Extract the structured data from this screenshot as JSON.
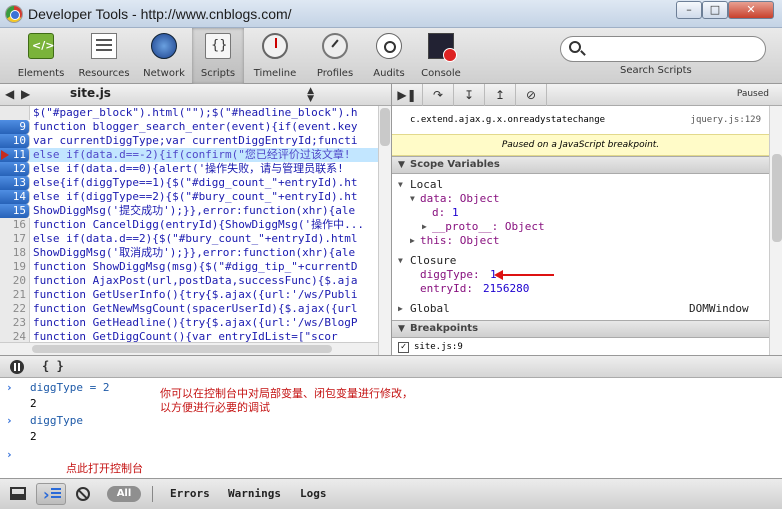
{
  "window": {
    "title": "Developer Tools - http://www.cnblogs.com/"
  },
  "toolbar": {
    "panels": [
      {
        "label": "Elements",
        "icon": "elements-icon"
      },
      {
        "label": "Resources",
        "icon": "resources-icon"
      },
      {
        "label": "Network",
        "icon": "network-icon"
      },
      {
        "label": "Scripts",
        "icon": "scripts-icon",
        "selected": true
      },
      {
        "label": "Timeline",
        "icon": "timeline-icon"
      },
      {
        "label": "Profiles",
        "icon": "profiles-icon"
      },
      {
        "label": "Audits",
        "icon": "audits-icon"
      },
      {
        "label": "Console",
        "icon": "console-icon"
      }
    ],
    "search_caption": "Search Scripts",
    "search_value": ""
  },
  "source": {
    "file": "site.js",
    "lines": [
      {
        "num": "",
        "text": "$(\"#pager_block\").html(\"\");$(\"#headline_block\").h"
      },
      {
        "num": "9",
        "breakpoint": true,
        "text": "function blogger_search_enter(event){if(event.key"
      },
      {
        "num": "10",
        "breakpoint": true,
        "text": "var currentDiggType;var currentDiggEntryId;functi"
      },
      {
        "num": "11",
        "breakpoint": true,
        "current": true,
        "text": "else if(data.d==-2){if(confirm(\"您已经评价过该文章!"
      },
      {
        "num": "12",
        "breakpoint": true,
        "text": "else if(data.d==0){alert('操作失败，请与管理员联系!"
      },
      {
        "num": "13",
        "breakpoint": true,
        "text": "else{if(diggType==1){$(\"#digg_count_\"+entryId).ht"
      },
      {
        "num": "14",
        "breakpoint": true,
        "text": "else if(diggType==2){$(\"#bury_count_\"+entryId).ht"
      },
      {
        "num": "15",
        "breakpoint": true,
        "text": "ShowDiggMsg('提交成功');}},error:function(xhr){ale"
      },
      {
        "num": "16",
        "text": "function CancelDigg(entryId){ShowDiggMsg('操作中..."
      },
      {
        "num": "17",
        "text": "else if(data.d==2){$(\"#bury_count_\"+entryId).html"
      },
      {
        "num": "18",
        "text": "ShowDiggMsg('取消成功');}},error:function(xhr){ale"
      },
      {
        "num": "19",
        "text": "function ShowDiggMsg(msg){$(\"#digg_tip_\"+currentD"
      },
      {
        "num": "20",
        "text": "function AjaxPost(url,postData,successFunc){$.aja"
      },
      {
        "num": "21",
        "text": "function GetUserInfo(){try{$.ajax({url:'/ws/Publi"
      },
      {
        "num": "22",
        "text": "function GetNewMsgCount(spacerUserId){$.ajax({url"
      },
      {
        "num": "23",
        "text": "function GetHeadline(){try{$.ajax({url:'/ws/BlogP"
      },
      {
        "num": "24",
        "text": "function GetDiggCount(){var entryIdList=[\"scor"
      }
    ]
  },
  "debugger": {
    "paused": "Paused",
    "callstack": {
      "fn": "c.extend.ajax.g.x.onreadystatechange",
      "loc": "jquery.js:129"
    },
    "paused_message": "Paused on a JavaScript breakpoint.",
    "scope_title": "Scope Variables",
    "local": "Local",
    "data": "data: Object",
    "d_name": "d:",
    "d_value": "1",
    "proto": "__proto__: Object",
    "this": "this: Object",
    "closure": "Closure",
    "diggType_name": "diggType:",
    "diggType_value": "1",
    "entryId_name": "entryId:",
    "entryId_value": "2156280",
    "global": "Global",
    "global_value": "DOMWindow",
    "breakpoints_title": "Breakpoints",
    "breakpoint_entry": "site.js:9"
  },
  "console": {
    "pretty": "{ }",
    "rows": [
      {
        "cmd": "diggType = 2",
        "result": "2"
      },
      {
        "cmd": "diggType",
        "result": "2"
      }
    ],
    "annotation_1": "你可以在控制台中对局部变量、闭包变量进行修改，",
    "annotation_2": "以方便进行必要的调试",
    "annotation_3": "点此打开控制台"
  },
  "statusbar": {
    "all": "All",
    "errors": "Errors",
    "warnings": "Warnings",
    "logs": "Logs"
  },
  "colors": {
    "annotation": "#c41212",
    "current_line": "#c2e6ff",
    "breakpoint": "#2762b8"
  }
}
